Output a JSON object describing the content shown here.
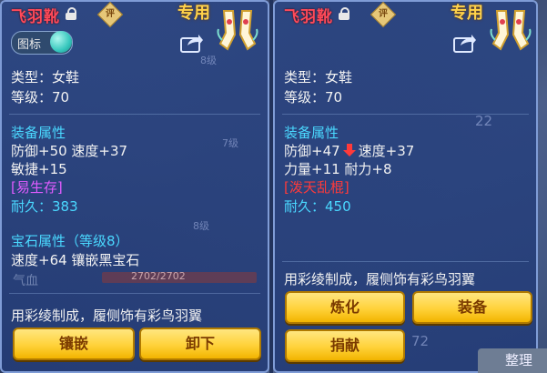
{
  "left": {
    "title": "飞羽靴",
    "badge": "评",
    "special": "专用",
    "toggle_label": "图标",
    "lines": {
      "type": "类型：女鞋",
      "level": "等级：70",
      "attr_header": "装备属性",
      "attr1": "防御+50 速度+37",
      "attr2": "敏捷+15",
      "special_skill": "[易生存]",
      "durability_label": "耐久：",
      "durability_value": "383",
      "gem_header": "宝石属性（等级8）",
      "gem_line": "速度+64 镶嵌黑宝石",
      "description": "用彩绫制成，履侧饰有彩鸟羽翼"
    },
    "buttons": {
      "inlay": "镶嵌",
      "unload": "卸下"
    },
    "background_text": {
      "hp": "气血",
      "hp_value": "2702/2702",
      "grade1": "7级",
      "grade2": "8级",
      "grade3": "8级"
    }
  },
  "right": {
    "title": "飞羽靴",
    "badge": "评",
    "special": "专用",
    "lines": {
      "type": "类型：女鞋",
      "level": "等级：70",
      "attr_header": "装备属性",
      "defense": "防御+47",
      "speed": "速度+37",
      "attr2": "力量+11 耐力+8",
      "special_skill": "[泼天乱棍]",
      "durability_label": "耐久：",
      "durability_value": "450",
      "description": "用彩绫制成，履侧饰有彩鸟羽翼"
    },
    "buttons": {
      "refine": "炼化",
      "equip": "装备",
      "donate": "捐献"
    },
    "background_text": {
      "n22": "22",
      "n72": "72",
      "corner": "整理"
    }
  },
  "colors": {
    "title": "#ff4a5a",
    "section": "#4ad8ff",
    "skill": "#e05cff",
    "button": "#ffd23a",
    "down_arrow": "#ff3a3a"
  }
}
